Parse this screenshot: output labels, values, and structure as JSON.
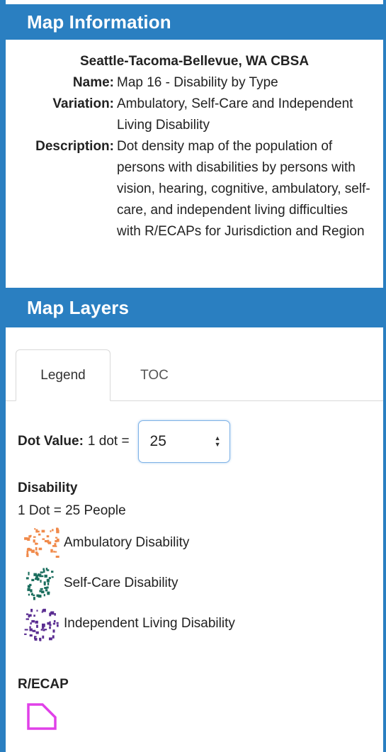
{
  "map_information": {
    "header": "Map Information",
    "region": "Seattle-Tacoma-Bellevue, WA CBSA",
    "name_label": "Name:",
    "name_value": "Map 16 - Disability by Type",
    "variation_label": "Variation:",
    "variation_value": "Ambulatory, Self-Care and Independent Living Disability",
    "description_label": "Description:",
    "description_value": "Dot density map of the population of persons with disabilities by persons with vision, hearing, cognitive, ambulatory, self-care, and independent living difficulties with R/ECAPs for Jurisdiction and Region"
  },
  "map_layers": {
    "header": "Map Layers",
    "tabs": [
      {
        "label": "Legend",
        "active": true
      },
      {
        "label": "TOC",
        "active": false
      }
    ],
    "dot_value": {
      "label": "Dot Value:",
      "prefix": "1 dot =",
      "selected": "25"
    },
    "legend": {
      "disability_title": "Disability",
      "disability_note": "1 Dot = 25 People",
      "items": [
        {
          "label": "Ambulatory Disability",
          "color": "#f08a4b"
        },
        {
          "label": "Self-Care Disability",
          "color": "#1b6e5e"
        },
        {
          "label": "Independent Living Disability",
          "color": "#5a2d91"
        }
      ],
      "recap_title": "R/ECAP",
      "recap_color": "#e040e8"
    }
  },
  "theme": {
    "accent": "#2a7fc1",
    "focus_border": "#7fb2e6"
  }
}
